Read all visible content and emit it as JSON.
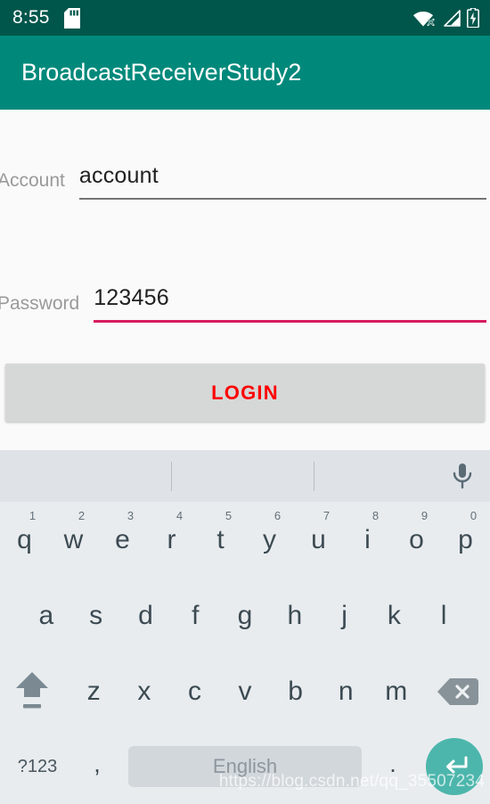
{
  "status_bar": {
    "clock": "8:55",
    "left_icons": [
      "sd-card-icon"
    ],
    "right_icons": [
      "wifi-disconnected-icon",
      "cell-signal-icon",
      "battery-charging-icon"
    ],
    "background_color": "#00564B",
    "foreground_color": "#FFFFFF"
  },
  "app_bar": {
    "title": "BroadcastReceiverStudy2",
    "background_color": "#00897B",
    "title_color": "#FFFFFF"
  },
  "form": {
    "fields": [
      {
        "label": "Account",
        "value": "account",
        "placeholder": "",
        "focused": false,
        "underline_color": "#757575"
      },
      {
        "label": "Password",
        "value": "123456",
        "placeholder": "",
        "focused": true,
        "underline_color": "#D81B60"
      }
    ],
    "login_button": {
      "label": "LOGIN",
      "text_color": "#FF0000",
      "background_color": "#D6D7D7"
    },
    "background_color": "#FAFAFA"
  },
  "keyboard": {
    "background_color": "#E8ECEF",
    "suggestion_bar": {
      "background_color": "#DFE3E7",
      "suggestions": [
        "",
        "",
        ""
      ],
      "mic_icon": "microphone-icon"
    },
    "row1": [
      {
        "letter": "q",
        "sup": "1"
      },
      {
        "letter": "w",
        "sup": "2"
      },
      {
        "letter": "e",
        "sup": "3"
      },
      {
        "letter": "r",
        "sup": "4"
      },
      {
        "letter": "t",
        "sup": "5"
      },
      {
        "letter": "y",
        "sup": "6"
      },
      {
        "letter": "u",
        "sup": "7"
      },
      {
        "letter": "i",
        "sup": "8"
      },
      {
        "letter": "o",
        "sup": "9"
      },
      {
        "letter": "p",
        "sup": "0"
      }
    ],
    "row2": [
      {
        "letter": "a"
      },
      {
        "letter": "s"
      },
      {
        "letter": "d"
      },
      {
        "letter": "f"
      },
      {
        "letter": "g"
      },
      {
        "letter": "h"
      },
      {
        "letter": "j"
      },
      {
        "letter": "k"
      },
      {
        "letter": "l"
      }
    ],
    "row3": {
      "shift": "shift-key-icon",
      "letters": [
        {
          "letter": "z"
        },
        {
          "letter": "x"
        },
        {
          "letter": "c"
        },
        {
          "letter": "v"
        },
        {
          "letter": "b"
        },
        {
          "letter": "n"
        },
        {
          "letter": "m"
        }
      ],
      "backspace": "backspace-icon"
    },
    "row4": {
      "symbols_label": "?123",
      "comma_label": ",",
      "space_label": "English",
      "period_label": ".",
      "enter_icon": "enter-return-icon",
      "enter_color": "#4DB6AC"
    }
  },
  "watermark": {
    "text": "https://blog.csdn.net/qq_35507234"
  }
}
